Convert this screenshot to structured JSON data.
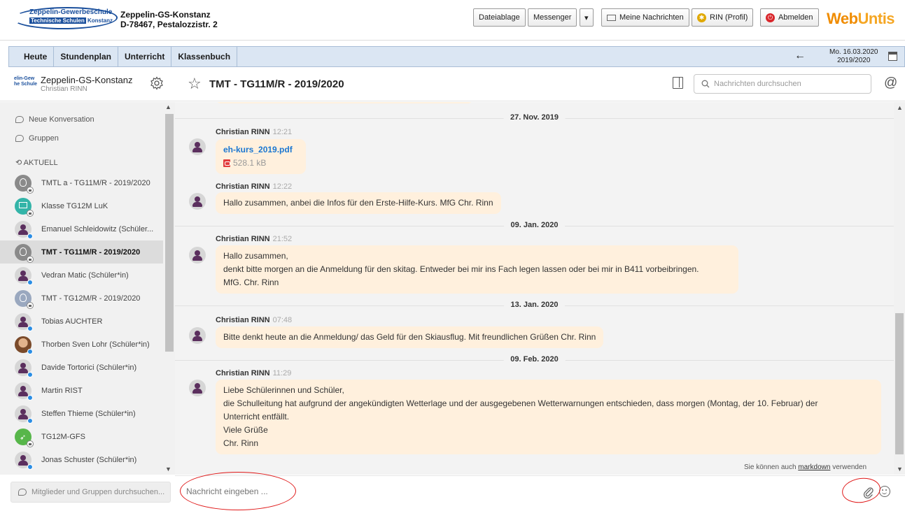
{
  "header": {
    "logo_line1": "Zeppelin-Gewerbeschule",
    "logo_line2a": "Technische Schulen",
    "logo_line2b": "Konstanz",
    "school_name": "Zeppelin-GS-Konstanz",
    "school_address": "D-78467, Pestalozzistr. 2",
    "buttons": {
      "dateiablage": "Dateiablage",
      "messenger": "Messenger",
      "messenger_dropdown": "▾",
      "meine_nachrichten": "Meine Nachrichten",
      "profil": "RIN (Profil)",
      "abmelden": "Abmelden"
    },
    "brand_web": "Web",
    "brand_untis": "Untis"
  },
  "nav": {
    "items": [
      "Heute",
      "Stundenplan",
      "Unterricht",
      "Klassenbuch"
    ],
    "back_arrow": "←",
    "date": "Mo. 16.03.2020",
    "school_year": "2019/2020"
  },
  "sidebar": {
    "logo_line1": "elin-Gew",
    "logo_line2": "he Schule",
    "school": "Zeppelin-GS-Konstanz",
    "user": "Christian RINN",
    "new_conversation": "Neue Konversation",
    "groups": "Gruppen",
    "section": "AKTUELL",
    "conversations": [
      {
        "label": "TMTL a - TG11M/R - 2019/2020"
      },
      {
        "label": "Klasse TG12M LuK"
      },
      {
        "label": "Emanuel Schleidowitz (Schüler..."
      },
      {
        "label": "TMT - TG11M/R - 2019/2020"
      },
      {
        "label": "Vedran Matic (Schüler*in)"
      },
      {
        "label": "TMT - TG12M/R - 2019/2020"
      },
      {
        "label": "Tobias AUCHTER"
      },
      {
        "label": "Thorben Sven Lohr (Schüler*in)"
      },
      {
        "label": "Davide Tortorici (Schüler*in)"
      },
      {
        "label": "Martin RIST"
      },
      {
        "label": "Steffen Thieme (Schüler*in)"
      },
      {
        "label": "TG12M-GFS"
      },
      {
        "label": "Jonas Schuster (Schüler*in)"
      }
    ],
    "search_placeholder": "Mitglieder und Gruppen durchsuchen..."
  },
  "chat": {
    "title": "TMT - TG11M/R - 2019/2020",
    "search_placeholder": "Nachrichten durchsuchen",
    "days": {
      "d1": "27. Nov. 2019",
      "d2": "09. Jan. 2020",
      "d3": "13. Jan. 2020",
      "d4": "09. Feb. 2020"
    },
    "messages": {
      "m1": {
        "sender": "Christian RINN",
        "time": "12:21",
        "file": "eh-kurs_2019.pdf",
        "size": "528.1 kB"
      },
      "m2": {
        "sender": "Christian RINN",
        "time": "12:22",
        "text": "Hallo zusammen, anbei die Infos für den Erste-Hilfe-Kurs. MfG Chr. Rinn"
      },
      "m3": {
        "sender": "Christian RINN",
        "time": "21:52",
        "line1": "Hallo zusammen,",
        "line2": "denkt bitte morgen an die Anmeldung für den skitag. Entweder bei mir ins Fach legen lassen oder bei mir in B411 vorbeibringen.",
        "line3": "MfG. Chr. Rinn"
      },
      "m4": {
        "sender": "Christian RINN",
        "time": "07:48",
        "text": "Bitte denkt heute an die Anmeldung/ das Geld für den Skiausflug. Mit freundlichen Grüßen Chr. Rinn"
      },
      "m5": {
        "sender": "Christian RINN",
        "time": "11:29",
        "line1": "Liebe Schülerinnen und Schüler,",
        "line2": "die Schulleitung hat aufgrund der angekündigten Wetterlage und der ausgegebenen Wetterwarnungen entschieden, dass morgen (Montag, der 10. Februar) der",
        "line3": "Unterricht entfällt.",
        "line4": "Viele Grüße",
        "line5": "Chr. Rinn"
      }
    },
    "markdown_prefix": "Sie können auch ",
    "markdown_link": "markdown",
    "markdown_suffix": " verwenden",
    "compose_placeholder": "Nachricht eingeben ..."
  },
  "colors": {
    "accent_orange": "#f08c00",
    "nav_bg": "#dbe6f3",
    "bubble_bg": "#fff0dd",
    "file_link": "#1b77d1",
    "annotation_red": "#e01a1a"
  }
}
